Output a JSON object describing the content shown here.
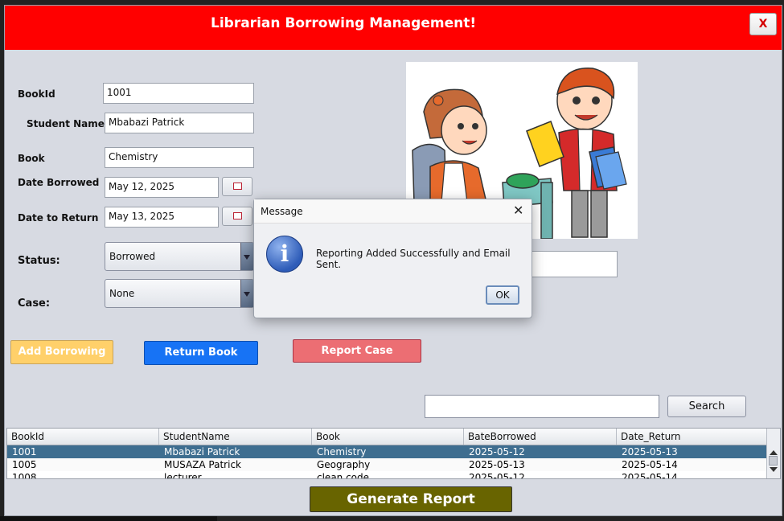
{
  "window": {
    "title": "Librarian Borrowing Management!",
    "close_label": "X"
  },
  "form": {
    "book_id": {
      "label": "BookId",
      "value": "1001"
    },
    "student_name": {
      "label": "Student Name",
      "value": "Mbabazi Patrick"
    },
    "book": {
      "label": "Book",
      "value": "Chemistry"
    },
    "date_borrowed": {
      "label": "Date Borrowed",
      "value": "May 12, 2025"
    },
    "date_return": {
      "label": "Date to Return",
      "value": "May 13, 2025"
    },
    "status": {
      "label": "Status:",
      "value": "Borrowed"
    },
    "case": {
      "label": "Case:",
      "value": "None"
    }
  },
  "buttons": {
    "add": "Add Borrowing",
    "return": "Return Book",
    "report": "Report Case",
    "search": "Search",
    "generate": "Generate Report"
  },
  "table": {
    "headers": [
      "BookId",
      "StudentName",
      "Book",
      "BateBorrowed",
      "Date_Return"
    ],
    "rows": [
      [
        "1001",
        "Mbabazi Patrick",
        "Chemistry",
        "2025-05-12",
        "2025-05-13"
      ],
      [
        "1005",
        "MUSAZA Patrick",
        "Geography",
        "2025-05-13",
        "2025-05-14"
      ],
      [
        "1008",
        "lecturer",
        "clean code",
        "2025-05-12",
        "2025-05-14"
      ]
    ]
  },
  "dialog": {
    "title": "Message",
    "close": "✕",
    "message": "Reporting Added Successfully and Email Sent.",
    "ok": "OK",
    "icon": "info-icon"
  },
  "colors": {
    "title_bar": "#ff0000",
    "add_button": "#ffd06a",
    "return_button": "#1773f5",
    "report_button": "#ec6e73",
    "generate_button": "#686400",
    "selected_row": "#3e6e90"
  }
}
